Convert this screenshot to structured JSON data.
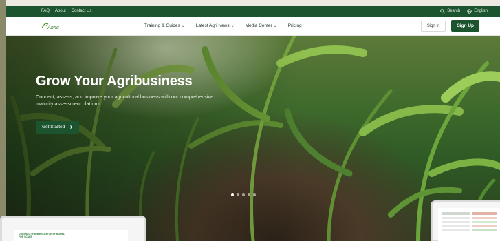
{
  "topbar": {
    "links": [
      "FAQ",
      "About",
      "Contact Us"
    ],
    "search_label": "Search",
    "language_label": "English"
  },
  "nav": {
    "logo_text": "Anna",
    "items": [
      {
        "label": "Training & Guides",
        "has_dropdown": true
      },
      {
        "label": "Latest Agri News",
        "has_dropdown": true
      },
      {
        "label": "Media Center",
        "has_dropdown": true
      },
      {
        "label": "Pricing",
        "has_dropdown": false
      }
    ],
    "signin_label": "Sign In",
    "signup_label": "Sign Up"
  },
  "hero": {
    "title": "Grow Your Agribusiness",
    "subtitle": "Connect, assess, and improve your agricultural business with our comprehensive maturity assessment platform",
    "cta_label": "Get Started",
    "slide_count": 5,
    "active_slide": 1
  },
  "preview_left": {
    "heading": "CONTRACT FARMING MATURITY MODEL FOR SCALE"
  },
  "colors": {
    "brand_green": "#1c5430",
    "topbar_bg": "#1c5430",
    "text_white": "#ffffff"
  },
  "icons": [
    "search-icon",
    "globe-icon",
    "chevron-down-icon",
    "arrow-right-icon"
  ]
}
